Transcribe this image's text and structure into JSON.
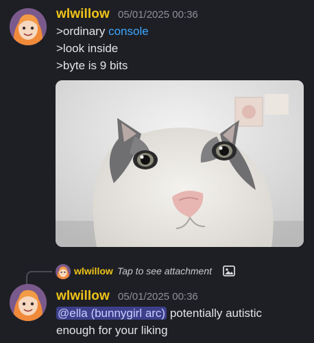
{
  "messages": [
    {
      "username": "wlwillow",
      "timestamp": "05/01/2025 00:36",
      "lines": [
        {
          "prefix": ">ordinary ",
          "link": "console"
        },
        {
          "text": ">look inside"
        },
        {
          "text": ">byte is 9 bits"
        }
      ],
      "attachment": {
        "icon": "cat-photo"
      }
    },
    {
      "reply": {
        "username": "wlwillow",
        "text": "Tap to see attachment",
        "icon": "image-icon"
      },
      "username": "wlwillow",
      "timestamp": "05/01/2025 00:36",
      "mention": "@ella (bunnygirl arc)",
      "text_after_mention": " potentially autistic",
      "text_line2": "enough for your liking"
    }
  ],
  "colors": {
    "background": "#1e1f24",
    "username": "#f0c419",
    "link": "#3ea6ff",
    "mention_bg": "#3c3f8a"
  }
}
